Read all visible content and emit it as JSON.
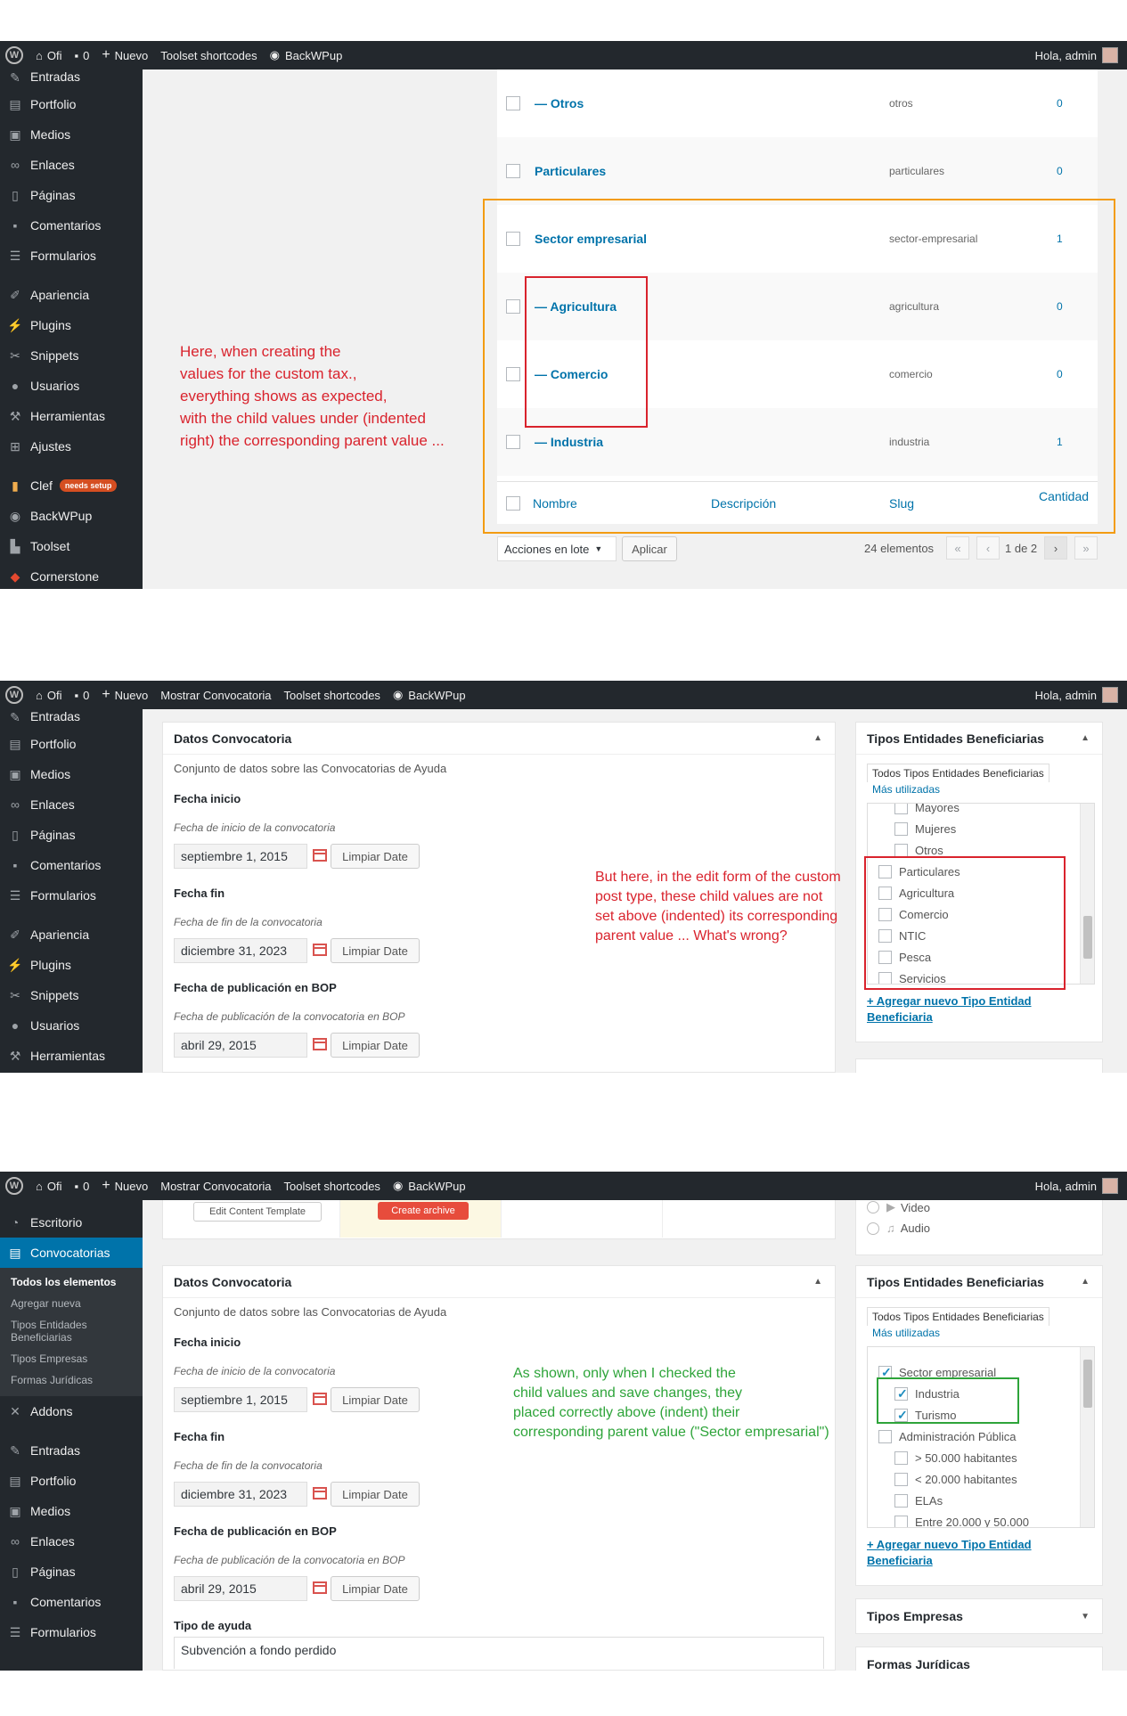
{
  "adminbar": {
    "logo": "W",
    "site": "Ofi",
    "comments": "0",
    "new": "Nuevo",
    "show_convocatoria": "Mostrar Convocatoria",
    "toolset": "Toolset shortcodes",
    "backwpup": "BackWPup",
    "greeting": "Hola, admin"
  },
  "menu": {
    "entradas": "Entradas",
    "portfolio": "Portfolio",
    "medios": "Medios",
    "enlaces": "Enlaces",
    "paginas": "Páginas",
    "comentarios": "Comentarios",
    "formularios": "Formularios",
    "apariencia": "Apariencia",
    "plugins": "Plugins",
    "snippets": "Snippets",
    "usuarios": "Usuarios",
    "herramientas": "Herramientas",
    "ajustes": "Ajustes",
    "clef": "Clef",
    "clef_badge": "needs setup",
    "backwpup": "BackWPup",
    "toolset": "Toolset",
    "cornerstone": "Cornerstone",
    "escritorio": "Escritorio",
    "convocatorias": "Convocatorias",
    "addons": "Addons",
    "submenu": [
      "Todos los elementos",
      "Agregar nueva",
      "Tipos Entidades Beneficiarias",
      "Tipos Empresas",
      "Formas Jurídicas"
    ]
  },
  "panel1": {
    "rows": [
      {
        "name": "— Otros",
        "slug": "otros",
        "count": "0"
      },
      {
        "name": "Particulares",
        "slug": "particulares",
        "count": "0"
      },
      {
        "name": "Sector empresarial",
        "slug": "sector-empresarial",
        "count": "1"
      },
      {
        "name": "— Agricultura",
        "slug": "agricultura",
        "count": "0"
      },
      {
        "name": "— Comercio",
        "slug": "comercio",
        "count": "0"
      },
      {
        "name": "— Industria",
        "slug": "industria",
        "count": "1"
      }
    ],
    "footer": {
      "nombre": "Nombre",
      "descripcion": "Descripción",
      "slug": "Slug",
      "cantidad": "Cantidad"
    },
    "bulk_actions": "Acciones en lote",
    "apply": "Aplicar",
    "items_count": "24 elementos",
    "pager": {
      "first": "«",
      "prev": "‹",
      "page": "1 de 2",
      "next": "›",
      "last": "»"
    },
    "annotation": [
      "Here, when creating the",
      "values for the custom tax.,",
      "everything shows as expected,",
      "with the child values under (indented",
      "right) the corresponding parent value ..."
    ]
  },
  "datos": {
    "title": "Datos Convocatoria",
    "collapse": "▲",
    "description": "Conjunto de datos sobre las Convocatorias de Ayuda",
    "fecha_inicio_label": "Fecha inicio",
    "fecha_inicio_desc": "Fecha de inicio de la convocatoria",
    "fecha_inicio_value": "septiembre 1, 2015",
    "fecha_fin_label": "Fecha fin",
    "fecha_fin_desc": "Fecha de fin de la convocatoria",
    "fecha_fin_value": "diciembre 31, 2023",
    "fecha_bop_label": "Fecha de publicación en BOP",
    "fecha_bop_desc": "Fecha de publicación de la convocatoria en BOP",
    "fecha_bop_value": "abril 29, 2015",
    "clear_label": "Limpiar Date",
    "tipo_ayuda_label": "Tipo de ayuda",
    "tipo_ayuda_value": "Subvención a fondo perdido"
  },
  "tipos_box": {
    "title": "Tipos Entidades Beneficiarias",
    "collapse": "▲",
    "tab_all": "Todos Tipos Entidades Beneficiarias",
    "tab_most_used": "Más utilizadas",
    "add_new": "+ Agregar nuevo Tipo Entidad Beneficiaria"
  },
  "panel2": {
    "list": [
      {
        "label": "Mayores",
        "indent": true,
        "checked": false
      },
      {
        "label": "Mujeres",
        "indent": true,
        "checked": false
      },
      {
        "label": "Otros",
        "indent": true,
        "checked": false
      },
      {
        "label": "Particulares",
        "indent": false,
        "checked": false
      },
      {
        "label": "Agricultura",
        "indent": false,
        "checked": false
      },
      {
        "label": "Comercio",
        "indent": false,
        "checked": false
      },
      {
        "label": "NTIC",
        "indent": false,
        "checked": false
      },
      {
        "label": "Pesca",
        "indent": false,
        "checked": false
      },
      {
        "label": "Servicios",
        "indent": false,
        "checked": false
      }
    ],
    "annotation": [
      "But here, in the edit form of the custom",
      "post type, these child values are not",
      "set above (indented) its corresponding",
      "parent value ... What's wrong?"
    ]
  },
  "panel3": {
    "edit_template": "Edit Content Template",
    "create_archive": "Create archive",
    "format_video": "Video",
    "format_audio": "Audio",
    "list": [
      {
        "label": "Sector empresarial",
        "indent": false,
        "checked": true
      },
      {
        "label": "Industria",
        "indent": true,
        "checked": true
      },
      {
        "label": "Turismo",
        "indent": true,
        "checked": true
      },
      {
        "label": "Administración Pública",
        "indent": false,
        "checked": false
      },
      {
        "label": "> 50.000 habitantes",
        "indent": true,
        "checked": false
      },
      {
        "label": "< 20.000 habitantes",
        "indent": true,
        "checked": false
      },
      {
        "label": "ELAs",
        "indent": true,
        "checked": false
      },
      {
        "label": "Entre 20.000 y 50.000",
        "indent": true,
        "checked": false
      }
    ],
    "tipos_empresas": "Tipos Empresas",
    "tipos_empresas_arrow": "▼",
    "formas_juridicas": "Formas Jurídicas",
    "annotation": [
      "As shown, only when I checked the",
      "child values and save changes, they",
      "placed correctly above (indent) their",
      "corresponding parent value (\"Sector empresarial\")"
    ]
  }
}
